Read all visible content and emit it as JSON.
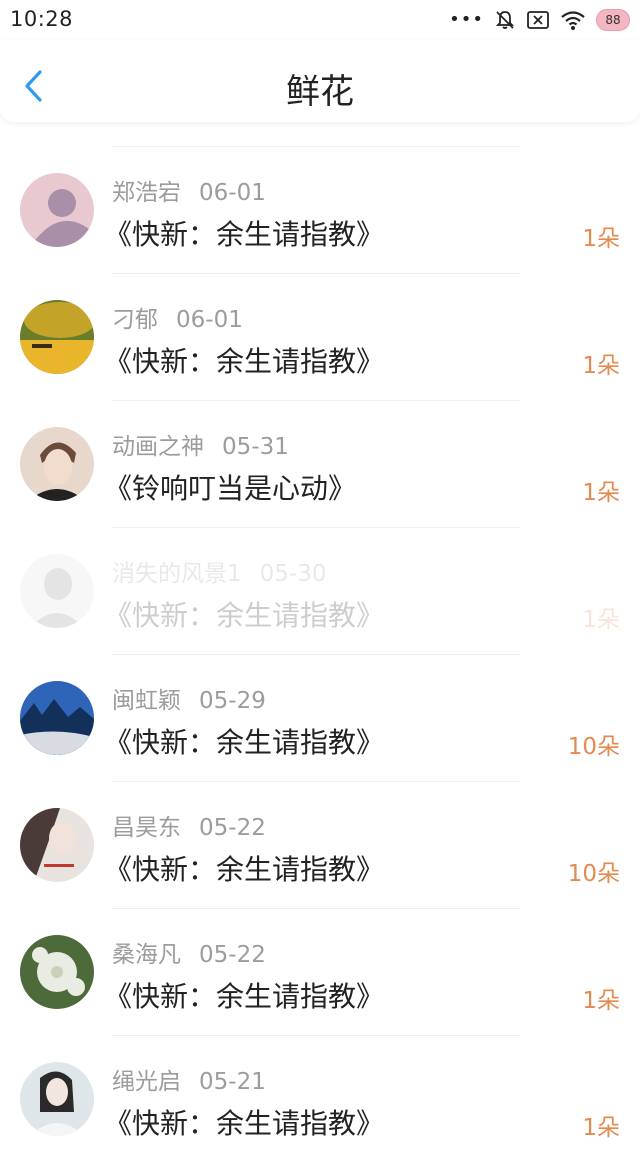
{
  "status_bar": {
    "time": "10:28",
    "dots": "•••",
    "battery": "88"
  },
  "header": {
    "title": "鲜花"
  },
  "items": [
    {
      "name": "郑浩宕",
      "date": "06-01",
      "book": "《快新：余生请指教》",
      "count": "1朵",
      "avatar_colors": [
        "#e8c9d0",
        "#a98fa7"
      ]
    },
    {
      "name": "刁郁",
      "date": "06-01",
      "book": "《快新：余生请指教》",
      "count": "1朵",
      "avatar_colors": [
        "#e9b52a",
        "#6a7d2a"
      ]
    },
    {
      "name": "动画之神",
      "date": "05-31",
      "book": "《铃响叮当是心动》",
      "count": "1朵",
      "avatar_colors": [
        "#e8d8cc",
        "#6b4a3a"
      ]
    },
    {
      "name": "消失的风景1",
      "date": "05-30",
      "book": "《快新：余生请指教》",
      "count": "1朵",
      "avatar_colors": [
        "#dcdcdc",
        "#8a8a8a"
      ]
    },
    {
      "name": "闽虹颖",
      "date": "05-29",
      "book": "《快新：余生请指教》",
      "count": "10朵",
      "avatar_colors": [
        "#2e65b8",
        "#d7dce3"
      ]
    },
    {
      "name": "昌昊东",
      "date": "05-22",
      "book": "《快新：余生请指教》",
      "count": "10朵",
      "avatar_colors": [
        "#e9e3e0",
        "#4a3a38"
      ]
    },
    {
      "name": "桑海凡",
      "date": "05-22",
      "book": "《快新：余生请指教》",
      "count": "1朵",
      "avatar_colors": [
        "#e8ece2",
        "#4d6a3a"
      ]
    },
    {
      "name": "绳光启",
      "date": "05-21",
      "book": "《快新：余生请指教》",
      "count": "1朵",
      "avatar_colors": [
        "#dfe6ea",
        "#2a2a2a"
      ]
    }
  ],
  "colors": {
    "accent": "#2d9bf0",
    "count": "#e58a4e"
  }
}
